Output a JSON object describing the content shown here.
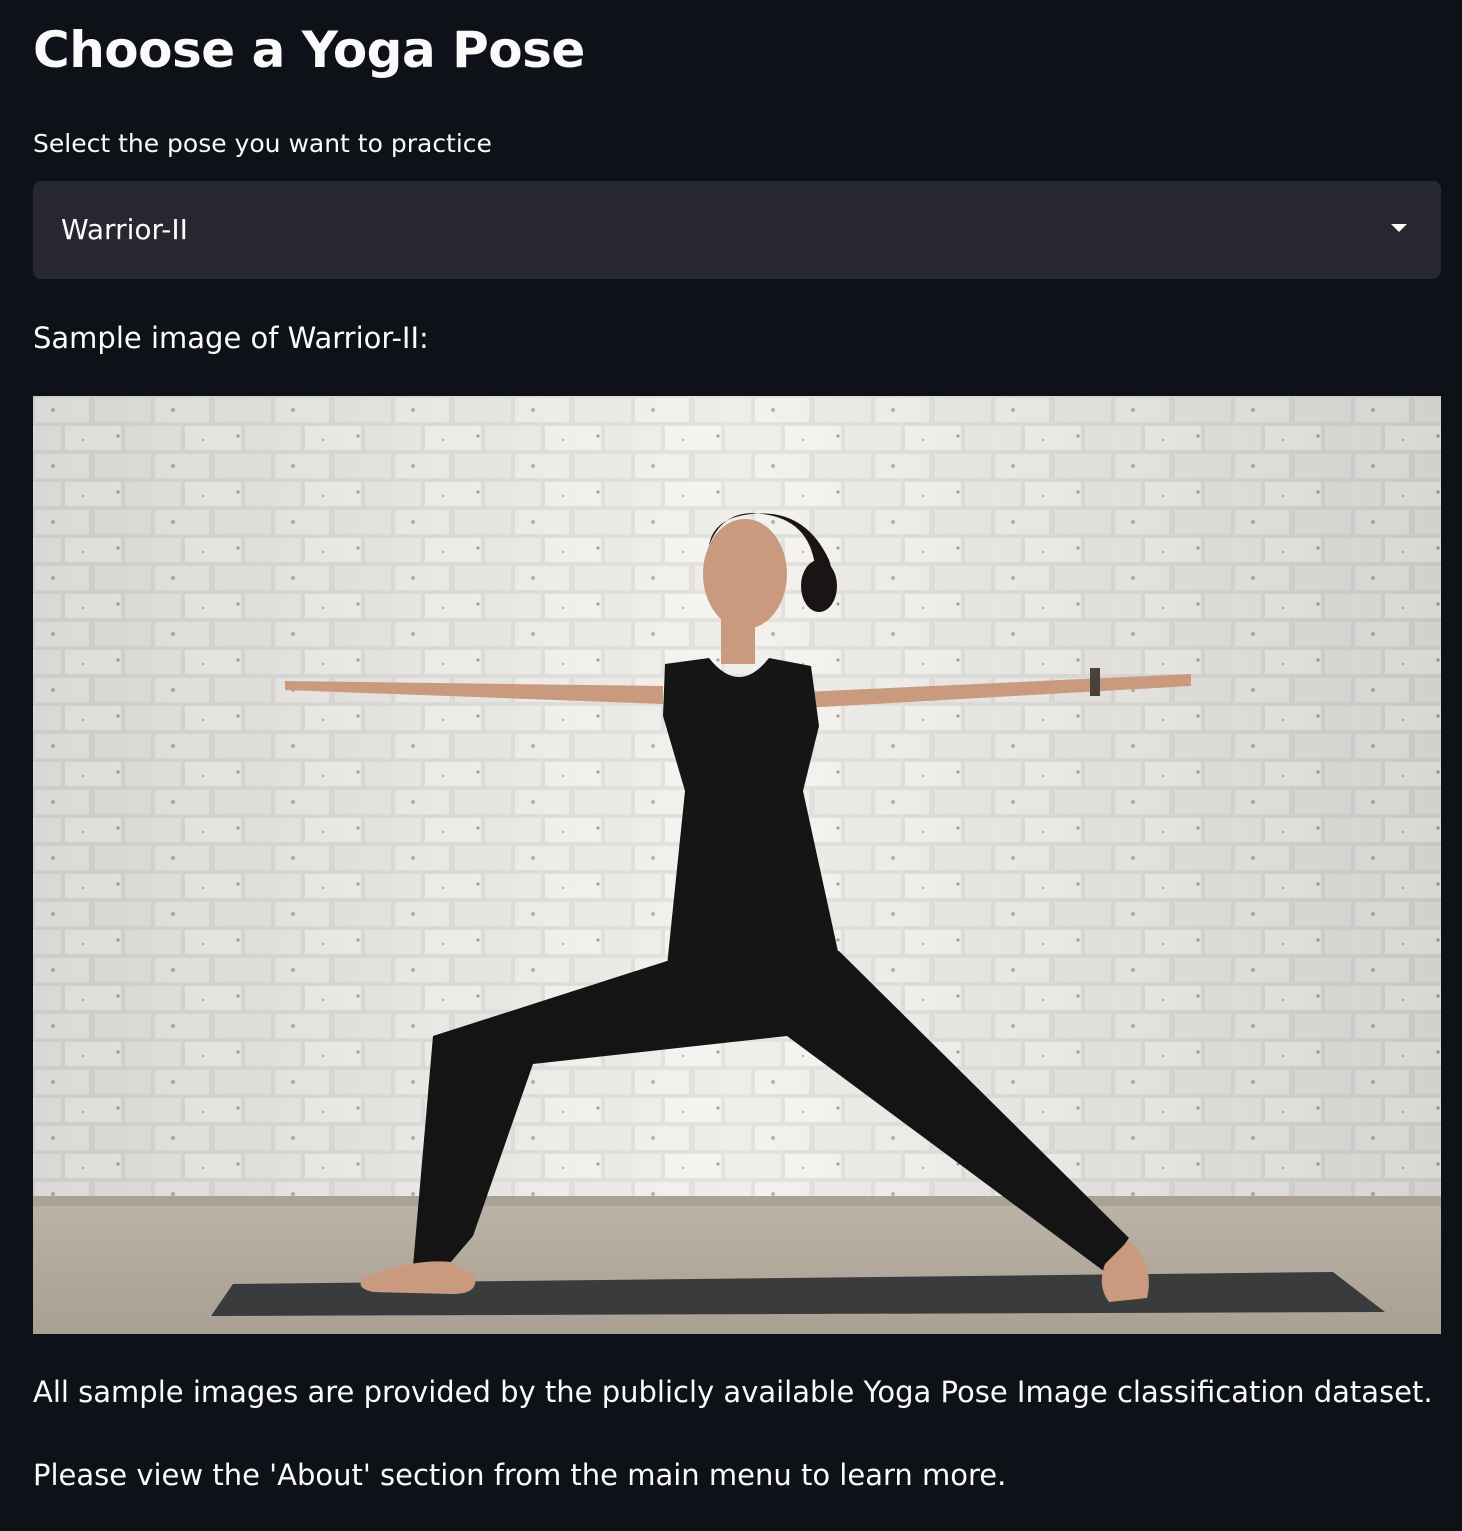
{
  "page": {
    "title": "Choose a Yoga Pose"
  },
  "pose_select": {
    "label": "Select the pose you want to practice",
    "selected_value": "Warrior-II",
    "icon": "chevron-down-icon"
  },
  "sample": {
    "caption": "Sample image of Warrior-II:",
    "image_alt": "Woman in black outfit performing Warrior-II yoga pose on a dark mat in front of a white brick wall"
  },
  "footer": {
    "note_1": "All sample images are provided by the publicly available Yoga Pose Image classification dataset.",
    "note_2": "Please view the 'About' section from the main menu to learn more."
  },
  "colors": {
    "background": "#0e1117",
    "select_background": "#262730",
    "text": "#fafafa"
  }
}
